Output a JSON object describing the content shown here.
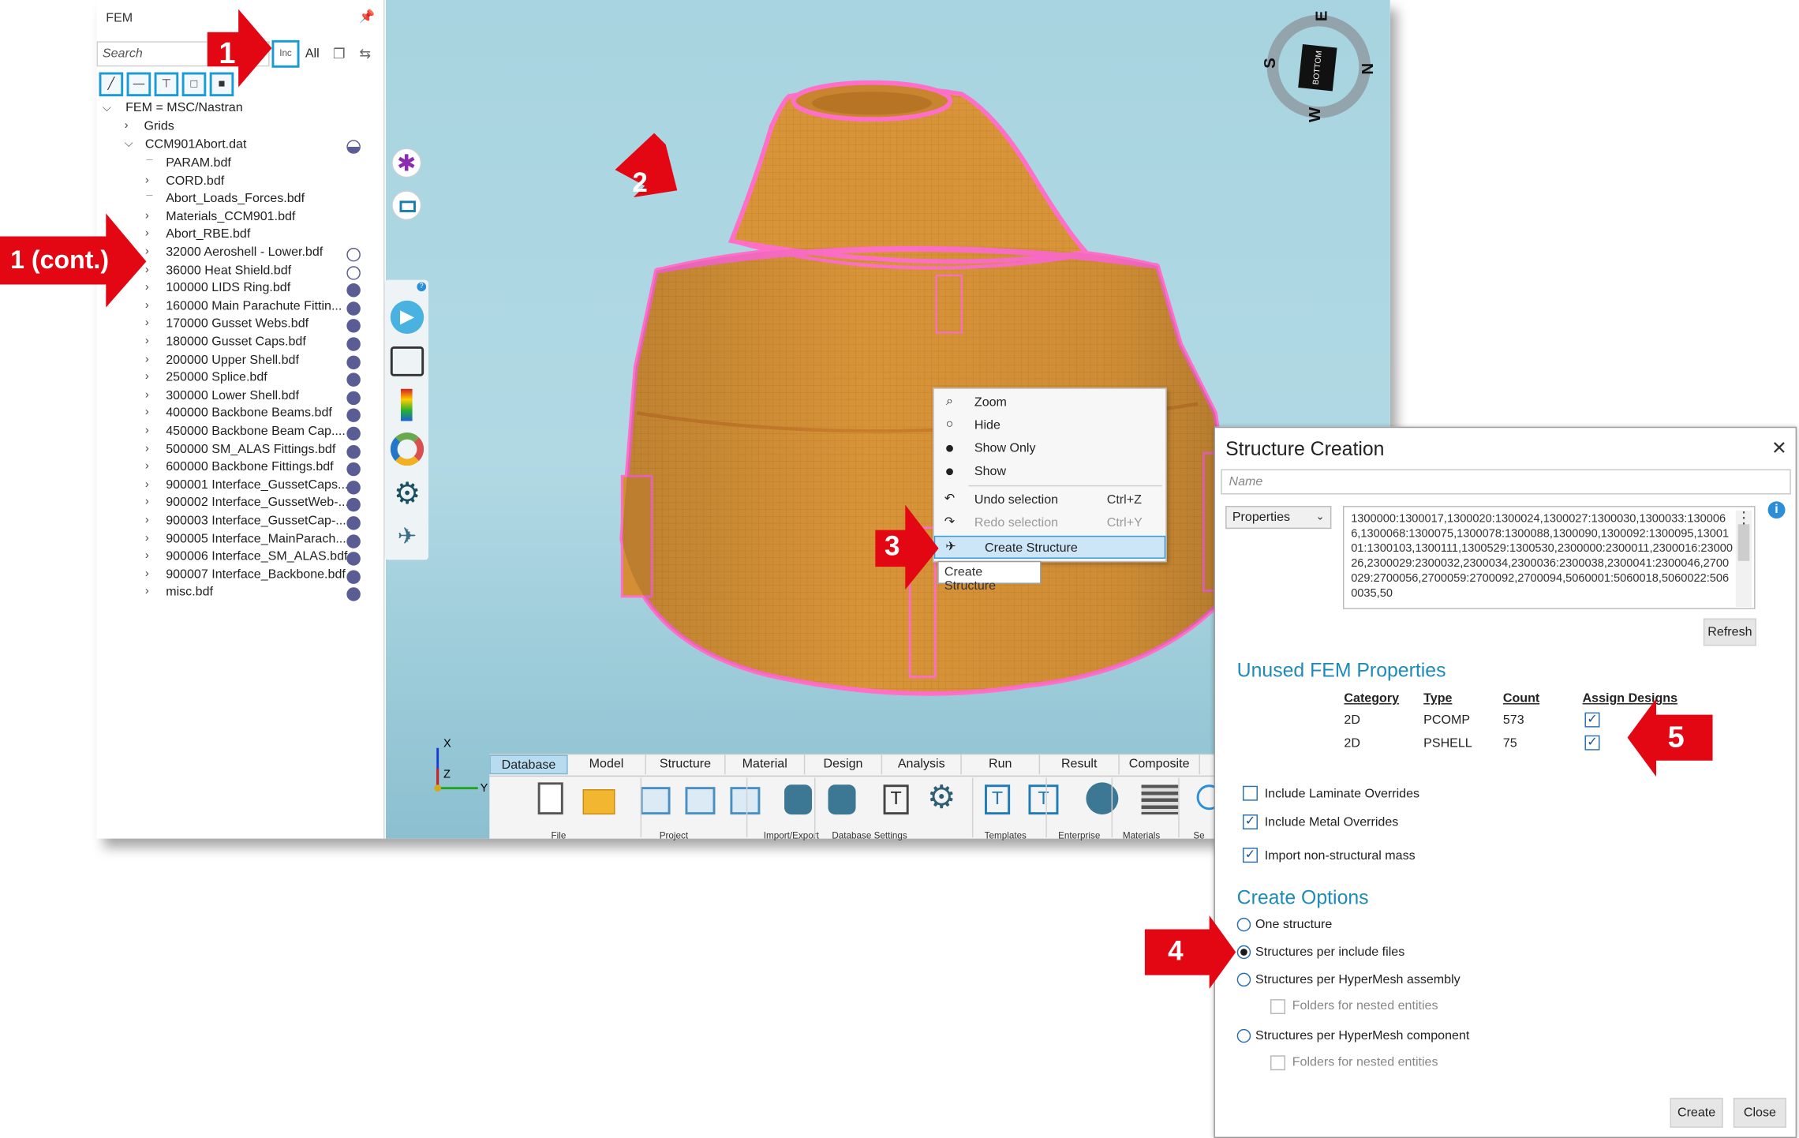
{
  "panel": {
    "title": "FEM",
    "pin_icon": "pin-icon",
    "search_placeholder": "Search",
    "inc_label": "Inc",
    "all_label": "All",
    "filter_icons": [
      "edge-filter-icon",
      "line-filter-icon",
      "beam-filter-icon",
      "face-filter-icon",
      "solid-filter-icon"
    ]
  },
  "tree": {
    "root": "FEM = MSC/Nastran",
    "grids": "Grids",
    "file": "CCM901Abort.dat",
    "items": [
      {
        "label": "PARAM.bdf",
        "expand": false,
        "dot": "none"
      },
      {
        "label": "CORD.bdf",
        "expand": true,
        "dot": "none"
      },
      {
        "label": "Abort_Loads_Forces.bdf",
        "expand": false,
        "dot": "none"
      },
      {
        "label": "Materials_CCM901.bdf",
        "expand": true,
        "dot": "none"
      },
      {
        "label": "Abort_RBE.bdf",
        "expand": true,
        "dot": "none"
      },
      {
        "label": "32000 Aeroshell - Lower.bdf",
        "expand": true,
        "dot": "empty"
      },
      {
        "label": "36000 Heat Shield.bdf",
        "expand": true,
        "dot": "empty"
      },
      {
        "label": "100000 LIDS Ring.bdf",
        "expand": true,
        "dot": "full"
      },
      {
        "label": "160000 Main Parachute Fittin...",
        "expand": true,
        "dot": "full"
      },
      {
        "label": "170000 Gusset Webs.bdf",
        "expand": true,
        "dot": "full"
      },
      {
        "label": "180000 Gusset Caps.bdf",
        "expand": true,
        "dot": "full"
      },
      {
        "label": "200000 Upper Shell.bdf",
        "expand": true,
        "dot": "full"
      },
      {
        "label": "250000 Splice.bdf",
        "expand": true,
        "dot": "full"
      },
      {
        "label": "300000 Lower Shell.bdf",
        "expand": true,
        "dot": "full"
      },
      {
        "label": "400000 Backbone Beams.bdf",
        "expand": true,
        "dot": "full"
      },
      {
        "label": "450000 Backbone Beam Cap....",
        "expand": true,
        "dot": "full"
      },
      {
        "label": "500000 SM_ALAS Fittings.bdf",
        "expand": true,
        "dot": "full"
      },
      {
        "label": "600000 Backbone Fittings.bdf",
        "expand": true,
        "dot": "full"
      },
      {
        "label": "900001 Interface_GussetCaps...",
        "expand": true,
        "dot": "full"
      },
      {
        "label": "900002 Interface_GussetWeb-...",
        "expand": true,
        "dot": "full"
      },
      {
        "label": "900003 Interface_GussetCap-...",
        "expand": true,
        "dot": "full"
      },
      {
        "label": "900005 Interface_MainParach...",
        "expand": true,
        "dot": "full"
      },
      {
        "label": "900006 Interface_SM_ALAS.bdf",
        "expand": true,
        "dot": "full"
      },
      {
        "label": "900007 Interface_Backbone.bdf",
        "expand": true,
        "dot": "full"
      },
      {
        "label": "misc.bdf",
        "expand": true,
        "dot": "full"
      }
    ]
  },
  "nav_cube": {
    "face": "BOTTOM",
    "letters": [
      "E",
      "N",
      "W",
      "S"
    ]
  },
  "axes": {
    "x": "X",
    "y": "Y",
    "z": "Z"
  },
  "context_menu": [
    {
      "label": "Zoom",
      "shortcut": "",
      "icon": "zoom-icon",
      "disabled": false
    },
    {
      "label": "Hide",
      "shortcut": "",
      "icon": "hide-icon",
      "disabled": false
    },
    {
      "label": "Show Only",
      "shortcut": "",
      "icon": "show-only-icon",
      "disabled": false
    },
    {
      "label": "Show",
      "shortcut": "",
      "icon": "show-icon",
      "disabled": false
    },
    {
      "label": "Undo selection",
      "shortcut": "Ctrl+Z",
      "icon": "undo-icon",
      "disabled": false
    },
    {
      "label": "Redo selection",
      "shortcut": "Ctrl+Y",
      "icon": "redo-icon",
      "disabled": true
    },
    {
      "label": "Create Structure",
      "shortcut": "",
      "icon": "airplane-icon",
      "disabled": false
    }
  ],
  "tooltip": "Create Structure",
  "ribbon": {
    "tabs": [
      "Database",
      "Model",
      "Structure",
      "Material",
      "Design",
      "Analysis",
      "Run",
      "Result",
      "Composite"
    ],
    "active_tab": "Database",
    "groups": [
      "File",
      "Project",
      "Import/Export",
      "Database Settings",
      "Templates",
      "Enterprise",
      "Materials",
      "Se"
    ]
  },
  "dialog": {
    "title": "Structure Creation",
    "name_placeholder": "Name",
    "source_select": "Properties",
    "ids_text": "1300000:1300017,1300020:1300024,1300027:1300030,1300033:1300066,1300068:1300075,1300078:1300088,1300090,1300092:1300095,1300101:1300103,1300111,1300529:1300530,2300000:2300011,2300016:2300026,2300029:2300032,2300034,2300036:2300038,2300041:2300046,2700029:2700056,2700059:2700092,2700094,5060001:5060018,5060022:5060035,50",
    "refresh": "Refresh",
    "unused_title": "Unused FEM Properties",
    "columns": [
      "Category",
      "Type",
      "Count",
      "Assign Designs"
    ],
    "rows": [
      {
        "category": "2D",
        "type": "PCOMP",
        "count": "573",
        "assign": true
      },
      {
        "category": "2D",
        "type": "PSHELL",
        "count": "75",
        "assign": true
      }
    ],
    "checks": [
      {
        "label": "Include Laminate Overrides",
        "checked": false
      },
      {
        "label": "Include Metal Overrides",
        "checked": true
      },
      {
        "label": "Import non-structural mass",
        "checked": true
      }
    ],
    "options_title": "Create Options",
    "options": [
      {
        "label": "One structure",
        "selected": false
      },
      {
        "label": "Structures per include files",
        "selected": true
      },
      {
        "label": "Structures per HyperMesh assembly",
        "selected": false
      },
      {
        "label": "Structures per HyperMesh component",
        "selected": false
      }
    ],
    "nested_label": "Folders for nested entities",
    "create": "Create",
    "close": "Close"
  },
  "callouts": {
    "c1": "1",
    "c1b": "1 (cont.)",
    "c2": "2",
    "c3": "3",
    "c4": "4",
    "c5": "5"
  },
  "colors": {
    "accent": "#1a9ad6",
    "callout": "#e30613",
    "mesh": "#d99535",
    "mesh_edge": "#ff66c4",
    "sky": "#a7d4e0",
    "dot": "#5a5d94"
  }
}
